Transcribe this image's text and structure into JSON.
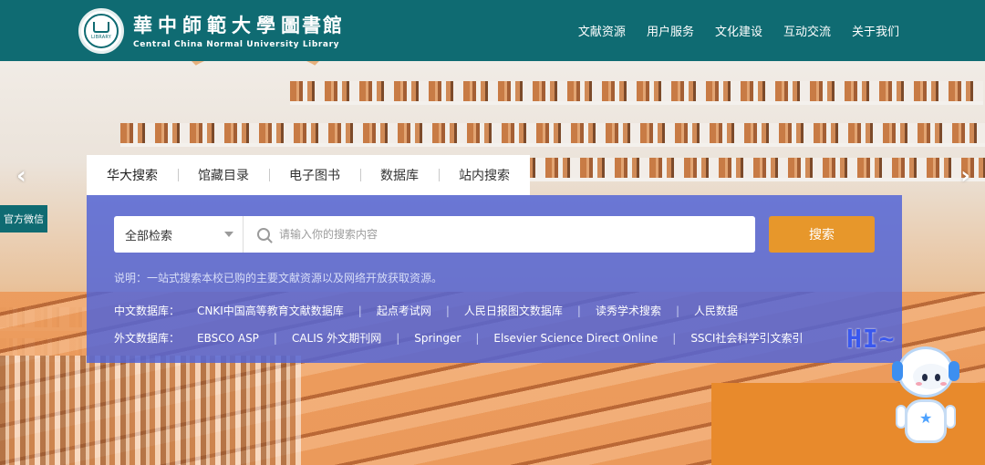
{
  "header": {
    "logo_cn": "華中師範大學",
    "logo_lib": "圖書館",
    "logo_en": "Central China Normal University Library",
    "seal_text": "LIBRARY",
    "nav": [
      "文献资源",
      "用户服务",
      "文化建设",
      "互动交流",
      "关于我们"
    ]
  },
  "hero": {
    "prev_icon": "‹",
    "next_icon": "›"
  },
  "wechat_label": "官方微信",
  "search": {
    "tabs": [
      "华大搜索",
      "馆藏目录",
      "电子图书",
      "数据库",
      "站内搜索"
    ],
    "active_tab": 0,
    "scope": "全部检索",
    "placeholder": "请输入你的搜索内容",
    "button": "搜索",
    "description": "说明：一站式搜索本校已购的主要文献资源以及网络开放获取资源。",
    "cn_label": "中文数据库：",
    "cn_databases": [
      "CNKI中国高等教育文献数据库",
      "起点考试网",
      "人民日报图文数据库",
      "读秀学术搜索",
      "人民数据"
    ],
    "en_label": "外文数据库：",
    "en_databases": [
      "EBSCO ASP",
      "CALIS 外文期刊网",
      "Springer",
      "Elsevier Science Direct Online",
      "SSCI社会科学引文索引"
    ]
  },
  "mascot": {
    "greeting": "HI~"
  },
  "colors": {
    "header": "#0f6b72",
    "panel": "#5365d6",
    "search_button": "#e7972b"
  }
}
